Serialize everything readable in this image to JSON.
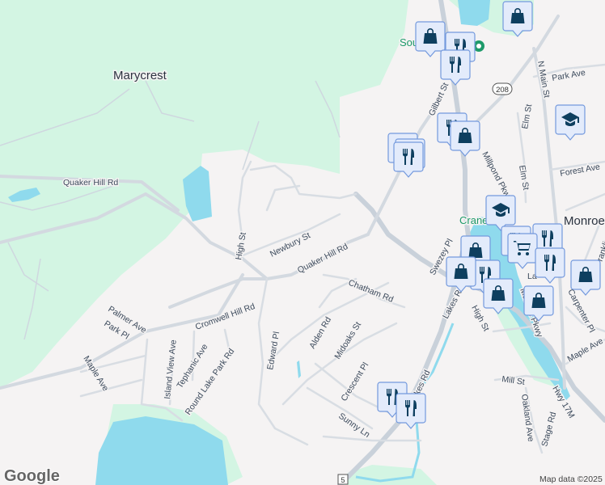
{
  "places": {
    "marycrest": "Marycrest",
    "monroe": "Monroe",
    "south_family_poi": "South Family",
    "crane_poi": "Crane",
    "lake_poi": "La"
  },
  "streets": {
    "quaker_hill_rd_west": "Quaker Hill Rd",
    "quaker_hill_rd": "Quaker Hill Rd",
    "newbury_st": "Newbury St",
    "high_st_west": "High St",
    "cromwell_hill_rd": "Cromwell Hill Rd",
    "palmer_ave": "Palmer Ave",
    "park_pl": "Park Pl",
    "maple_ave_west": "Maple Ave",
    "island_view_ave": "Island View Ave",
    "tephanic_ave": "Tephanic Ave",
    "round_lake_park_rd": "Round Lake Park Rd",
    "edward_pl": "Edward Pl",
    "alden_rd": "Alden Rd",
    "midoaks_st": "Midoaks St",
    "chatham_rd": "Chatham Rd",
    "crescent_pl": "Crescent Pl",
    "sunny_ln": "Sunny Ln",
    "lakes_rd": "Lakes Rd",
    "lakes_rd_south": "Lakes Rd",
    "swezey_pl": "Swezey Pl",
    "high_st_east": "High St",
    "gilbert_st": "Gilbert St",
    "millpond_pkwy": "Millpond Pkwy",
    "n_main_st": "N Main St",
    "park_ave": "Park Ave",
    "elm_st": "Elm St",
    "elm_st_2": "Elm St",
    "forest_ave": "Forest Ave",
    "franklin_ave": "Franklin Ave",
    "carpenter_pl": "Carpenter Pl",
    "maple_ave_east": "Maple Ave",
    "mill_st": "Mill St",
    "oakland_ave": "Oakland Ave",
    "stage_rd": "Stage Rd",
    "hwy_17m": "Hwy 17M",
    "main_pkwy": "Main St Pkwy"
  },
  "shields": {
    "route_208": "208",
    "route_5": "5"
  },
  "attribution": {
    "logo": "Google",
    "map_data": "Map data ©2025"
  },
  "markers": [
    {
      "type": "shopping"
    },
    {
      "type": "shopping"
    },
    {
      "type": "restaurant"
    },
    {
      "type": "restaurant"
    },
    {
      "type": "school"
    },
    {
      "type": "restaurant"
    },
    {
      "type": "shopping"
    },
    {
      "type": "restaurant"
    },
    {
      "type": "restaurant"
    },
    {
      "type": "restaurant"
    },
    {
      "type": "school"
    },
    {
      "type": "restaurant"
    },
    {
      "type": "restaurant"
    },
    {
      "type": "grocery"
    },
    {
      "type": "restaurant"
    },
    {
      "type": "shopping"
    },
    {
      "type": "restaurant"
    },
    {
      "type": "shopping"
    },
    {
      "type": "shopping"
    },
    {
      "type": "shopping"
    },
    {
      "type": "shopping"
    },
    {
      "type": "restaurant"
    },
    {
      "type": "restaurant"
    }
  ],
  "colors": {
    "land": "#f5f3f3",
    "park": "#d3f5e3",
    "water": "#8fdaed",
    "road": "#d3d9e0",
    "marker_fill": "#e3ebfb",
    "marker_icon": "#0e3f5f",
    "poi_green": "#1e9a6a"
  }
}
